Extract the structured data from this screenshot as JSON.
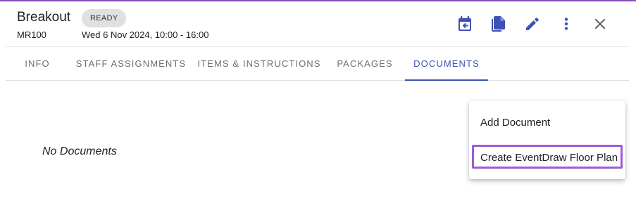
{
  "header": {
    "title": "Breakout",
    "status": "READY",
    "code": "MR100",
    "datetime": "Wed 6 Nov 2024, 10:00 - 16:00"
  },
  "toolbar": {
    "icons": [
      "calendar-icon",
      "document-icon",
      "edit-icon",
      "more-vert-icon",
      "close-icon"
    ],
    "accent_color": "#3f51b5"
  },
  "tabs": [
    {
      "label": "INFO",
      "active": false
    },
    {
      "label": "STAFF ASSIGNMENTS",
      "active": false
    },
    {
      "label": "ITEMS & INSTRUCTIONS",
      "active": false
    },
    {
      "label": "PACKAGES",
      "active": false
    },
    {
      "label": "DOCUMENTS",
      "active": true
    }
  ],
  "main": {
    "empty_message": "No Documents"
  },
  "menu": {
    "items": [
      {
        "label": "Add Document"
      },
      {
        "label": "Create EventDraw Floor Plan",
        "highlighted": true
      }
    ],
    "highlight_color": "#9b5dd6"
  }
}
